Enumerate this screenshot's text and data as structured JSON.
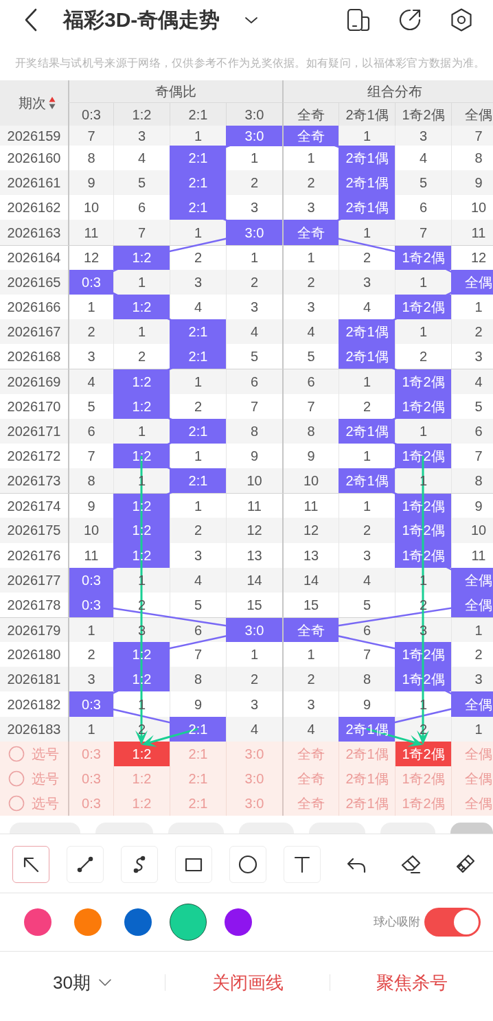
{
  "header": {
    "title": "福彩3D-奇偶走势"
  },
  "notice": "开奖结果与试机号来源于网络，仅供参考不作为兑奖依据。如有疑问，以福体彩官方数据为准。",
  "table": {
    "period_column": {
      "label": "期次",
      "sort_ascending": true
    },
    "groups": [
      {
        "title": "奇偶比",
        "columns": [
          "0:3",
          "1:2",
          "2:1",
          "3:0"
        ]
      },
      {
        "title": "组合分布",
        "columns": [
          "全奇",
          "2奇1偶",
          "1奇2偶",
          "全偶"
        ]
      }
    ],
    "rows": [
      {
        "period": "2026159",
        "groups": [
          [
            {
              "text": "7",
              "hit": false
            },
            {
              "text": "3",
              "hit": false
            },
            {
              "text": "1",
              "hit": false
            },
            {
              "text": "3:0",
              "hit": true
            }
          ],
          [
            {
              "text": "全奇",
              "hit": true
            },
            {
              "text": "1",
              "hit": false
            },
            {
              "text": "3",
              "hit": false
            },
            {
              "text": "7",
              "hit": false
            }
          ]
        ]
      },
      {
        "period": "2026160",
        "groups": [
          [
            {
              "text": "8",
              "hit": false
            },
            {
              "text": "4",
              "hit": false
            },
            {
              "text": "2:1",
              "hit": true
            },
            {
              "text": "1",
              "hit": false
            }
          ],
          [
            {
              "text": "1",
              "hit": false
            },
            {
              "text": "2奇1偶",
              "hit": true
            },
            {
              "text": "4",
              "hit": false
            },
            {
              "text": "8",
              "hit": false
            }
          ]
        ]
      },
      {
        "period": "2026161",
        "groups": [
          [
            {
              "text": "9",
              "hit": false
            },
            {
              "text": "5",
              "hit": false
            },
            {
              "text": "2:1",
              "hit": true
            },
            {
              "text": "2",
              "hit": false
            }
          ],
          [
            {
              "text": "2",
              "hit": false
            },
            {
              "text": "2奇1偶",
              "hit": true
            },
            {
              "text": "5",
              "hit": false
            },
            {
              "text": "9",
              "hit": false
            }
          ]
        ]
      },
      {
        "period": "2026162",
        "groups": [
          [
            {
              "text": "10",
              "hit": false
            },
            {
              "text": "6",
              "hit": false
            },
            {
              "text": "2:1",
              "hit": true
            },
            {
              "text": "3",
              "hit": false
            }
          ],
          [
            {
              "text": "3",
              "hit": false
            },
            {
              "text": "2奇1偶",
              "hit": true
            },
            {
              "text": "6",
              "hit": false
            },
            {
              "text": "10",
              "hit": false
            }
          ]
        ]
      },
      {
        "period": "2026163",
        "groups": [
          [
            {
              "text": "11",
              "hit": false
            },
            {
              "text": "7",
              "hit": false
            },
            {
              "text": "1",
              "hit": false
            },
            {
              "text": "3:0",
              "hit": true
            }
          ],
          [
            {
              "text": "全奇",
              "hit": true
            },
            {
              "text": "1",
              "hit": false
            },
            {
              "text": "7",
              "hit": false
            },
            {
              "text": "11",
              "hit": false
            }
          ]
        ]
      },
      {
        "period": "2026164",
        "groups": [
          [
            {
              "text": "12",
              "hit": false
            },
            {
              "text": "1:2",
              "hit": true
            },
            {
              "text": "2",
              "hit": false
            },
            {
              "text": "1",
              "hit": false
            }
          ],
          [
            {
              "text": "1",
              "hit": false
            },
            {
              "text": "2",
              "hit": false
            },
            {
              "text": "1奇2偶",
              "hit": true
            },
            {
              "text": "12",
              "hit": false
            }
          ]
        ]
      },
      {
        "period": "2026165",
        "groups": [
          [
            {
              "text": "0:3",
              "hit": true
            },
            {
              "text": "1",
              "hit": false
            },
            {
              "text": "3",
              "hit": false
            },
            {
              "text": "2",
              "hit": false
            }
          ],
          [
            {
              "text": "2",
              "hit": false
            },
            {
              "text": "3",
              "hit": false
            },
            {
              "text": "1",
              "hit": false
            },
            {
              "text": "全偶",
              "hit": true
            }
          ]
        ]
      },
      {
        "period": "2026166",
        "groups": [
          [
            {
              "text": "1",
              "hit": false
            },
            {
              "text": "1:2",
              "hit": true
            },
            {
              "text": "4",
              "hit": false
            },
            {
              "text": "3",
              "hit": false
            }
          ],
          [
            {
              "text": "3",
              "hit": false
            },
            {
              "text": "4",
              "hit": false
            },
            {
              "text": "1奇2偶",
              "hit": true
            },
            {
              "text": "1",
              "hit": false
            }
          ]
        ]
      },
      {
        "period": "2026167",
        "groups": [
          [
            {
              "text": "2",
              "hit": false
            },
            {
              "text": "1",
              "hit": false
            },
            {
              "text": "2:1",
              "hit": true
            },
            {
              "text": "4",
              "hit": false
            }
          ],
          [
            {
              "text": "4",
              "hit": false
            },
            {
              "text": "2奇1偶",
              "hit": true
            },
            {
              "text": "1",
              "hit": false
            },
            {
              "text": "2",
              "hit": false
            }
          ]
        ]
      },
      {
        "period": "2026168",
        "groups": [
          [
            {
              "text": "3",
              "hit": false
            },
            {
              "text": "2",
              "hit": false
            },
            {
              "text": "2:1",
              "hit": true
            },
            {
              "text": "5",
              "hit": false
            }
          ],
          [
            {
              "text": "5",
              "hit": false
            },
            {
              "text": "2奇1偶",
              "hit": true
            },
            {
              "text": "2",
              "hit": false
            },
            {
              "text": "3",
              "hit": false
            }
          ]
        ]
      },
      {
        "period": "2026169",
        "groups": [
          [
            {
              "text": "4",
              "hit": false
            },
            {
              "text": "1:2",
              "hit": true
            },
            {
              "text": "1",
              "hit": false
            },
            {
              "text": "6",
              "hit": false
            }
          ],
          [
            {
              "text": "6",
              "hit": false
            },
            {
              "text": "1",
              "hit": false
            },
            {
              "text": "1奇2偶",
              "hit": true
            },
            {
              "text": "4",
              "hit": false
            }
          ]
        ]
      },
      {
        "period": "2026170",
        "groups": [
          [
            {
              "text": "5",
              "hit": false
            },
            {
              "text": "1:2",
              "hit": true
            },
            {
              "text": "2",
              "hit": false
            },
            {
              "text": "7",
              "hit": false
            }
          ],
          [
            {
              "text": "7",
              "hit": false
            },
            {
              "text": "2",
              "hit": false
            },
            {
              "text": "1奇2偶",
              "hit": true
            },
            {
              "text": "5",
              "hit": false
            }
          ]
        ]
      },
      {
        "period": "2026171",
        "groups": [
          [
            {
              "text": "6",
              "hit": false
            },
            {
              "text": "1",
              "hit": false
            },
            {
              "text": "2:1",
              "hit": true
            },
            {
              "text": "8",
              "hit": false
            }
          ],
          [
            {
              "text": "8",
              "hit": false
            },
            {
              "text": "2奇1偶",
              "hit": true
            },
            {
              "text": "1",
              "hit": false
            },
            {
              "text": "6",
              "hit": false
            }
          ]
        ]
      },
      {
        "period": "2026172",
        "groups": [
          [
            {
              "text": "7",
              "hit": false
            },
            {
              "text": "1:2",
              "hit": true
            },
            {
              "text": "1",
              "hit": false
            },
            {
              "text": "9",
              "hit": false
            }
          ],
          [
            {
              "text": "9",
              "hit": false
            },
            {
              "text": "1",
              "hit": false
            },
            {
              "text": "1奇2偶",
              "hit": true
            },
            {
              "text": "7",
              "hit": false
            }
          ]
        ]
      },
      {
        "period": "2026173",
        "groups": [
          [
            {
              "text": "8",
              "hit": false
            },
            {
              "text": "1",
              "hit": false
            },
            {
              "text": "2:1",
              "hit": true
            },
            {
              "text": "10",
              "hit": false
            }
          ],
          [
            {
              "text": "10",
              "hit": false
            },
            {
              "text": "2奇1偶",
              "hit": true
            },
            {
              "text": "1",
              "hit": false
            },
            {
              "text": "8",
              "hit": false
            }
          ]
        ]
      },
      {
        "period": "2026174",
        "groups": [
          [
            {
              "text": "9",
              "hit": false
            },
            {
              "text": "1:2",
              "hit": true
            },
            {
              "text": "1",
              "hit": false
            },
            {
              "text": "11",
              "hit": false
            }
          ],
          [
            {
              "text": "11",
              "hit": false
            },
            {
              "text": "1",
              "hit": false
            },
            {
              "text": "1奇2偶",
              "hit": true
            },
            {
              "text": "9",
              "hit": false
            }
          ]
        ]
      },
      {
        "period": "2026175",
        "groups": [
          [
            {
              "text": "10",
              "hit": false
            },
            {
              "text": "1:2",
              "hit": true
            },
            {
              "text": "2",
              "hit": false
            },
            {
              "text": "12",
              "hit": false
            }
          ],
          [
            {
              "text": "12",
              "hit": false
            },
            {
              "text": "2",
              "hit": false
            },
            {
              "text": "1奇2偶",
              "hit": true
            },
            {
              "text": "10",
              "hit": false
            }
          ]
        ]
      },
      {
        "period": "2026176",
        "groups": [
          [
            {
              "text": "11",
              "hit": false
            },
            {
              "text": "1:2",
              "hit": true
            },
            {
              "text": "3",
              "hit": false
            },
            {
              "text": "13",
              "hit": false
            }
          ],
          [
            {
              "text": "13",
              "hit": false
            },
            {
              "text": "3",
              "hit": false
            },
            {
              "text": "1奇2偶",
              "hit": true
            },
            {
              "text": "11",
              "hit": false
            }
          ]
        ]
      },
      {
        "period": "2026177",
        "groups": [
          [
            {
              "text": "0:3",
              "hit": true
            },
            {
              "text": "1",
              "hit": false
            },
            {
              "text": "4",
              "hit": false
            },
            {
              "text": "14",
              "hit": false
            }
          ],
          [
            {
              "text": "14",
              "hit": false
            },
            {
              "text": "4",
              "hit": false
            },
            {
              "text": "1",
              "hit": false
            },
            {
              "text": "全偶",
              "hit": true
            }
          ]
        ]
      },
      {
        "period": "2026178",
        "groups": [
          [
            {
              "text": "0:3",
              "hit": true
            },
            {
              "text": "2",
              "hit": false
            },
            {
              "text": "5",
              "hit": false
            },
            {
              "text": "15",
              "hit": false
            }
          ],
          [
            {
              "text": "15",
              "hit": false
            },
            {
              "text": "5",
              "hit": false
            },
            {
              "text": "2",
              "hit": false
            },
            {
              "text": "全偶",
              "hit": true
            }
          ]
        ]
      },
      {
        "period": "2026179",
        "groups": [
          [
            {
              "text": "1",
              "hit": false
            },
            {
              "text": "3",
              "hit": false
            },
            {
              "text": "6",
              "hit": false
            },
            {
              "text": "3:0",
              "hit": true
            }
          ],
          [
            {
              "text": "全奇",
              "hit": true
            },
            {
              "text": "6",
              "hit": false
            },
            {
              "text": "3",
              "hit": false
            },
            {
              "text": "1",
              "hit": false
            }
          ]
        ]
      },
      {
        "period": "2026180",
        "groups": [
          [
            {
              "text": "2",
              "hit": false
            },
            {
              "text": "1:2",
              "hit": true
            },
            {
              "text": "7",
              "hit": false
            },
            {
              "text": "1",
              "hit": false
            }
          ],
          [
            {
              "text": "1",
              "hit": false
            },
            {
              "text": "7",
              "hit": false
            },
            {
              "text": "1奇2偶",
              "hit": true
            },
            {
              "text": "2",
              "hit": false
            }
          ]
        ]
      },
      {
        "period": "2026181",
        "groups": [
          [
            {
              "text": "3",
              "hit": false
            },
            {
              "text": "1:2",
              "hit": true
            },
            {
              "text": "8",
              "hit": false
            },
            {
              "text": "2",
              "hit": false
            }
          ],
          [
            {
              "text": "2",
              "hit": false
            },
            {
              "text": "8",
              "hit": false
            },
            {
              "text": "1奇2偶",
              "hit": true
            },
            {
              "text": "3",
              "hit": false
            }
          ]
        ]
      },
      {
        "period": "2026182",
        "groups": [
          [
            {
              "text": "0:3",
              "hit": true
            },
            {
              "text": "1",
              "hit": false
            },
            {
              "text": "9",
              "hit": false
            },
            {
              "text": "3",
              "hit": false
            }
          ],
          [
            {
              "text": "3",
              "hit": false
            },
            {
              "text": "9",
              "hit": false
            },
            {
              "text": "1",
              "hit": false
            },
            {
              "text": "全偶",
              "hit": true
            }
          ]
        ]
      },
      {
        "period": "2026183",
        "groups": [
          [
            {
              "text": "1",
              "hit": false
            },
            {
              "text": "2",
              "hit": false
            },
            {
              "text": "2:1",
              "hit": true
            },
            {
              "text": "4",
              "hit": false
            }
          ],
          [
            {
              "text": "4",
              "hit": false
            },
            {
              "text": "2奇1偶",
              "hit": true
            },
            {
              "text": "2",
              "hit": false
            },
            {
              "text": "1",
              "hit": false
            }
          ]
        ]
      }
    ]
  },
  "selection_rows": [
    {
      "label": "选号",
      "selected": false,
      "groups": [
        [
          {
            "text": "0:3",
            "selected": false
          },
          {
            "text": "1:2",
            "selected": true
          },
          {
            "text": "2:1",
            "selected": false
          },
          {
            "text": "3:0",
            "selected": false
          }
        ],
        [
          {
            "text": "全奇",
            "selected": false
          },
          {
            "text": "2奇1偶",
            "selected": false
          },
          {
            "text": "1奇2偶",
            "selected": true
          },
          {
            "text": "全偶",
            "selected": false
          }
        ]
      ]
    },
    {
      "label": "选号",
      "selected": false,
      "groups": [
        [
          {
            "text": "0:3",
            "selected": false
          },
          {
            "text": "1:2",
            "selected": false
          },
          {
            "text": "2:1",
            "selected": false
          },
          {
            "text": "3:0",
            "selected": false
          }
        ],
        [
          {
            "text": "全奇",
            "selected": false
          },
          {
            "text": "2奇1偶",
            "selected": false
          },
          {
            "text": "1奇2偶",
            "selected": false
          },
          {
            "text": "全偶",
            "selected": false
          }
        ]
      ]
    },
    {
      "label": "选号",
      "selected": false,
      "groups": [
        [
          {
            "text": "0:3",
            "selected": false
          },
          {
            "text": "1:2",
            "selected": false
          },
          {
            "text": "2:1",
            "selected": false
          },
          {
            "text": "3:0",
            "selected": false
          }
        ],
        [
          {
            "text": "全奇",
            "selected": false
          },
          {
            "text": "2奇1偶",
            "selected": false
          },
          {
            "text": "1奇2偶",
            "selected": false
          },
          {
            "text": "全偶",
            "selected": false
          }
        ]
      ]
    }
  ],
  "chips": [
    {
      "selected": false
    },
    {
      "selected": false
    },
    {
      "selected": false
    },
    {
      "selected": false
    },
    {
      "selected": false
    },
    {
      "selected": false
    },
    {
      "selected": true
    }
  ],
  "tools": [
    {
      "kind": "arrow",
      "selected": true
    },
    {
      "kind": "line",
      "selected": false
    },
    {
      "kind": "curve",
      "selected": false
    },
    {
      "kind": "rectangle",
      "selected": false
    },
    {
      "kind": "ellipse",
      "selected": false
    },
    {
      "kind": "text",
      "selected": false
    }
  ],
  "actions": [
    {
      "kind": "undo"
    },
    {
      "kind": "eraser"
    },
    {
      "kind": "clear"
    }
  ],
  "colors": [
    {
      "color": "#f4417f",
      "selected": false
    },
    {
      "color": "#fb7a0a",
      "selected": false
    },
    {
      "color": "#0a64c8",
      "selected": false
    },
    {
      "color": "#19cf93",
      "selected": true
    },
    {
      "color": "#8e15ee",
      "selected": false
    }
  ],
  "snap": {
    "label": "球心吸附",
    "on": true
  },
  "footer": {
    "period_select": "30期",
    "buttons": [
      "关闭画线",
      "聚焦杀号"
    ]
  }
}
